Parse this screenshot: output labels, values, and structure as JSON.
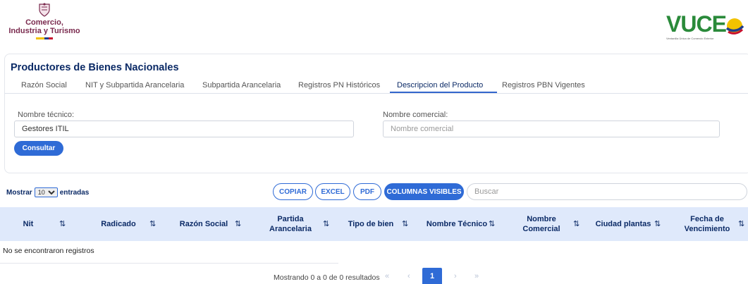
{
  "header": {
    "ministry_line1": "Comercio,",
    "ministry_line2": "Industria y Turismo",
    "brand": "VUCE",
    "brand_sub": "Ventanilla Única de Comercio Exterior"
  },
  "page": {
    "title": "Productores de Bienes Nacionales"
  },
  "tabs": [
    {
      "label": "Razón Social"
    },
    {
      "label": "NIT y Subpartida Arancelaria"
    },
    {
      "label": "Subpartida Arancelaria"
    },
    {
      "label": "Registros PN Históricos"
    },
    {
      "label": "Descripcion del Producto"
    },
    {
      "label": "Registros PBN Vigentes"
    }
  ],
  "form": {
    "nombre_tecnico_label": "Nombre técnico:",
    "nombre_tecnico_value": "Gestores ITIL",
    "nombre_comercial_label": "Nombre comercial:",
    "nombre_comercial_placeholder": "Nombre comercial",
    "consultar_label": "Consultar"
  },
  "toolbar": {
    "mostrar": "Mostrar",
    "entries_value": "10",
    "entradas": "entradas",
    "copiar": "COPIAR",
    "excel": "EXCEL",
    "pdf": "PDF",
    "columnas": "COLUMNAS VISIBLES",
    "search_placeholder": "Buscar"
  },
  "table": {
    "columns": [
      {
        "label": "Nit"
      },
      {
        "label": "Radicado"
      },
      {
        "label": "Razón Social"
      },
      {
        "label": "Partida Arancelaria"
      },
      {
        "label": "Tipo de bien"
      },
      {
        "label": "Nombre Técnico"
      },
      {
        "label": "Nombre Comercial"
      },
      {
        "label": "Ciudad plantas"
      },
      {
        "label": "Fecha de Vencimiento"
      }
    ],
    "sort_glyph": "⇅",
    "empty_message": "No se encontraron registros"
  },
  "pagination": {
    "info": "Mostrando 0 a 0 de 0 resultados",
    "first": "«",
    "prev": "‹",
    "current": "1",
    "next": "›",
    "last": "»"
  },
  "colors": {
    "primary": "#2f6bd6",
    "navy": "#0b2a66",
    "header_bg": "#dfe9fb",
    "brand_green": "#2a8a3a"
  }
}
